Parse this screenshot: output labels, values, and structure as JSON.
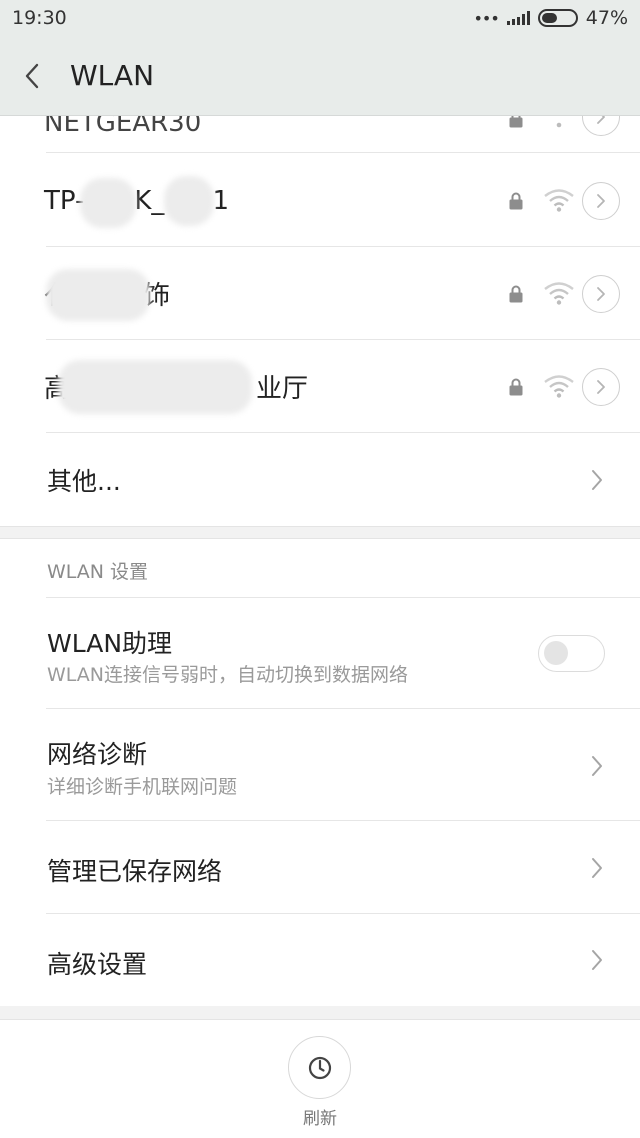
{
  "status_bar": {
    "time": "19:30",
    "dots": "•••",
    "battery": "47%",
    "battery_level": 0.47
  },
  "header": {
    "title": "WLAN",
    "back_icon": "chevron-left-icon"
  },
  "networks": [
    {
      "name": "NETGEAR30",
      "secured": true,
      "partially_visible": true
    },
    {
      "name_prefix": "TP-",
      "name_mid": "K_",
      "name_suffix": "1",
      "secured": true
    },
    {
      "name_prefix": "亻",
      "name_suffix": "饰",
      "secured": true
    },
    {
      "name_prefix": "高",
      "name_suffix": "业厅",
      "secured": true
    }
  ],
  "other": {
    "label": "其他..."
  },
  "settings_section": {
    "title": "WLAN 设置",
    "assistant": {
      "title": "WLAN助理",
      "subtitle": "WLAN连接信号弱时，自动切换到数据网络",
      "enabled": false
    },
    "diagnose": {
      "title": "网络诊断",
      "subtitle": "详细诊断手机联网问题"
    },
    "saved_networks": {
      "title": "管理已保存网络"
    },
    "advanced": {
      "title": "高级设置"
    }
  },
  "bottom": {
    "refresh_label": "刷新",
    "refresh_icon": "power-refresh-icon"
  },
  "colors": {
    "header_bg": "#e8ecea",
    "divider": "#e6e6e6",
    "icon_grey": "#9b9b9b"
  }
}
